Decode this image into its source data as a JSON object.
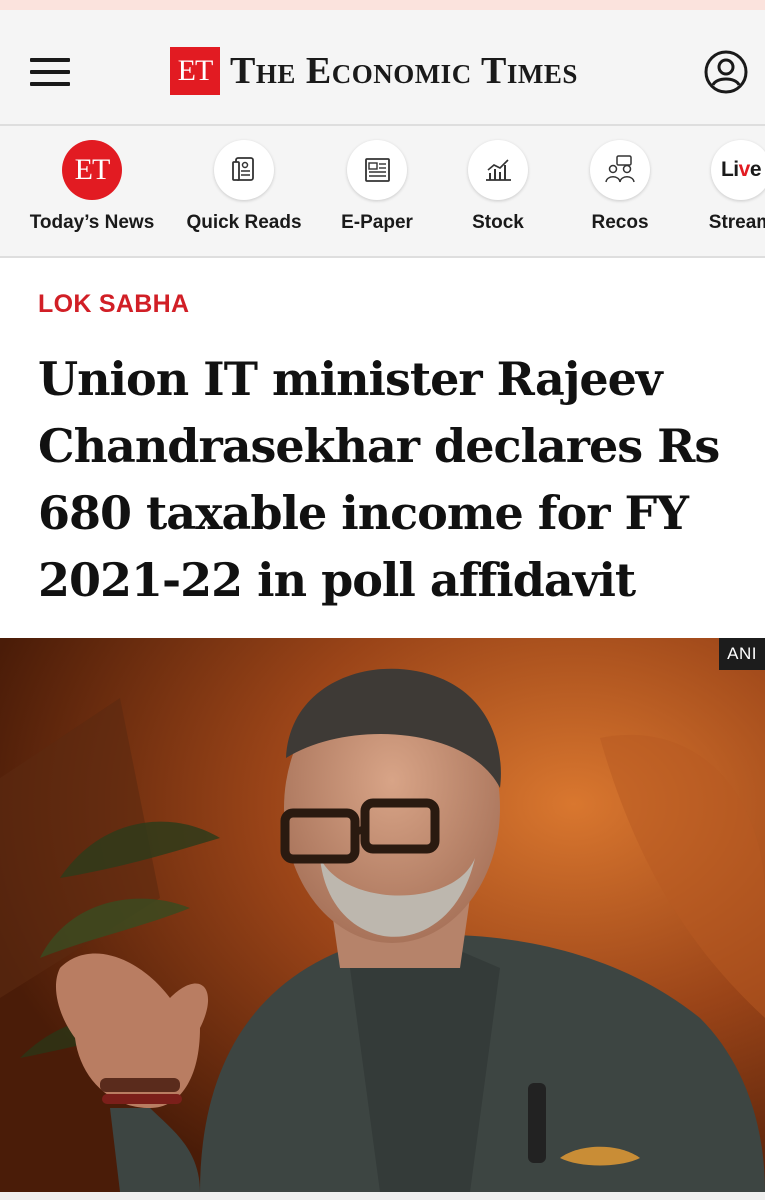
{
  "header": {
    "logo_badge": "ET",
    "logo_text": "The Economic Times"
  },
  "quick_nav": [
    {
      "label": "Today’s News",
      "icon": "et-logo-icon"
    },
    {
      "label": "Quick Reads",
      "icon": "quick-reads-icon"
    },
    {
      "label": "E-Paper",
      "icon": "newspaper-icon"
    },
    {
      "label": "Stock",
      "icon": "stock-chart-icon"
    },
    {
      "label": "Recos",
      "icon": "recos-people-icon"
    },
    {
      "label": "Stream",
      "icon": "live-icon",
      "icon_text": "Live"
    }
  ],
  "article": {
    "category": "LOK SABHA",
    "headline": "Union IT minister Rajeev Chandrasekhar declares Rs 680 taxable income for FY 2021-22 in poll affidavit",
    "image_credit": "ANI"
  },
  "colors": {
    "brand_red": "#e21b22",
    "category_red": "#d11f26",
    "header_bg": "#f5f5f5"
  }
}
